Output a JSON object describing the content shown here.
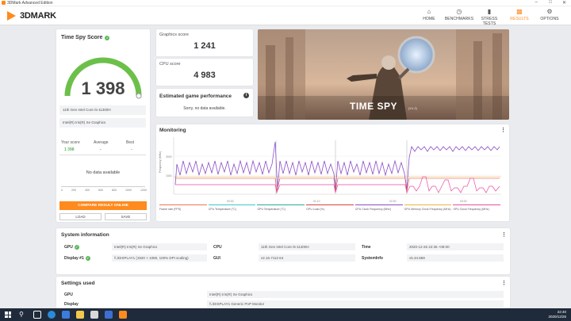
{
  "titlebar": {
    "title": "3DMark Advanced Edition"
  },
  "brand": {
    "logo": "3DMARK",
    "accent": "#ff8a1e"
  },
  "nav": [
    {
      "icon": "home-icon",
      "label": "HOME",
      "active": false
    },
    {
      "icon": "benchmarks-icon",
      "label": "BENCHMARKS",
      "active": false
    },
    {
      "icon": "stress-tests-icon",
      "label": "STRESS TESTS",
      "active": false
    },
    {
      "icon": "results-icon",
      "label": "RESULTS",
      "active": true
    },
    {
      "icon": "gear-icon",
      "label": "OPTIONS",
      "active": false
    }
  ],
  "score": {
    "title": "Time Spy Score",
    "value": "1 398",
    "cpu_name": "11th Gen Intel Core i5-11300H",
    "gpu_name": "Intel(R) Iris(R) Xe Graphics",
    "your_score_label": "Your score",
    "your_score": "1 398",
    "average_label": "Average",
    "average": "-",
    "best_label": "Best",
    "best": "-",
    "no_data": "No data available",
    "axis_ticks": [
      "0",
      "200",
      "400",
      "600",
      "800",
      "1000",
      "1200"
    ],
    "compare_button": "COMPARE RESULT ONLINE",
    "load_button": "LOAD",
    "save_button": "SAVE"
  },
  "graphics": {
    "label": "Graphics score",
    "value": "1 241"
  },
  "cpu": {
    "label": "CPU score",
    "value": "4 983"
  },
  "egp": {
    "title": "Estimated game performance",
    "message": "Sorry, no data available."
  },
  "hero": {
    "title": "TIME SPY",
    "version": "(V1.2)"
  },
  "monitoring": {
    "title": "Monitoring",
    "legend": [
      {
        "label": "Frame rate (FPS)",
        "color": "#e8754f"
      },
      {
        "label": "CPU Temperature (°C)",
        "color": "#3cc8c8"
      },
      {
        "label": "GPU Temperature (°C)",
        "color": "#2aa7a0"
      },
      {
        "label": "GPU Load (%)",
        "color": "#d94040"
      },
      {
        "label": "CPU Clock Frequency (MHz)",
        "color": "#8c4fc8"
      },
      {
        "label": "GPU Memory Clock Frequency (MHz)",
        "color": "#e8b83c"
      },
      {
        "label": "GPU Clock Frequency (MHz)",
        "color": "#e84fa0"
      }
    ]
  },
  "system": {
    "title": "System information",
    "gpu_label": "GPU",
    "gpu_value": "Intel(R) Iris(R) Xe Graphics",
    "display_label": "Display #1",
    "display_value": "\\\\.\\DISPLAY1 (1920 × 1080, 100% DPI scaling)",
    "cpu_label": "CPU",
    "cpu_value": "11th Gen Intel Core i5-11300H",
    "gui_label": "GUI",
    "gui_value": "v2.16.7113 64",
    "time_label": "Time",
    "time_value": "2020-12-26 22:36 +08:00",
    "sysinfo_label": "SystemInfo",
    "sysinfo_value": "v5.34.869"
  },
  "settings": {
    "title": "Settings used",
    "gpu_label": "GPU",
    "gpu_value": "Intel(R) Iris(R) Xe Graphics",
    "display_label": "Display",
    "display_value": "\\\\.\\DISPLAY1 Generic PnP Monitor"
  },
  "taskbar": {
    "time": "22:40",
    "date": "2020/12/26"
  }
}
